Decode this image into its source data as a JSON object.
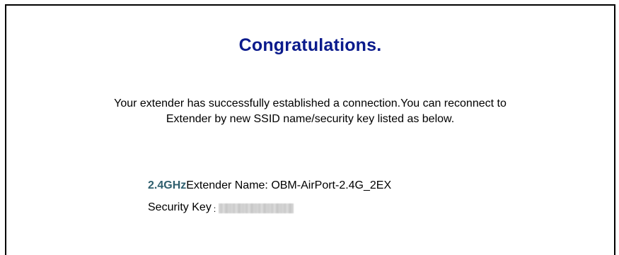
{
  "title": "Congratulations.",
  "message": {
    "line1": "Your extender has successfully established a connection.You can reconnect to",
    "line2": "Extender by new SSID name/security key listed as below."
  },
  "network": {
    "band_label": "2.4GHz",
    "name_label": "Extender Name:",
    "name_value": "OBM-AirPort-2.4G_2EX",
    "key_label": "Security Key",
    "key_separator": ":"
  },
  "colors": {
    "title": "#0a1a8c",
    "band": "#2f5f6e"
  }
}
